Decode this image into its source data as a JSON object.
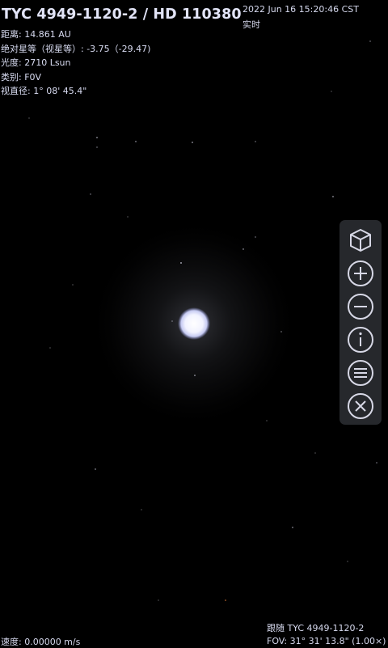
{
  "header": {
    "object_name": "TYC 4949-1120-2 / HD 110380",
    "datetime": "2022 Jun 16 15:20:46 CST",
    "time_mode": "实时"
  },
  "info": {
    "distance": "距离:  14.861 AU",
    "magnitude": "绝对星等（视星等）: -3.75（-29.47)",
    "luminosity": "光度: 2710 Lsun",
    "class": "类别:  F0V",
    "apparent_diameter": "视直径:  1° 08' 45.4\""
  },
  "status": {
    "speed": "速度:  0.00000 m/s",
    "follow": "跟随 TYC 4949-1120-2",
    "fov": "FOV:  31° 31' 13.8\" (1.00×)"
  },
  "toolbar": {
    "buttons": [
      {
        "name": "cube-view-icon"
      },
      {
        "name": "zoom-in-icon"
      },
      {
        "name": "zoom-out-icon"
      },
      {
        "name": "info-icon"
      },
      {
        "name": "menu-icon"
      },
      {
        "name": "close-icon"
      }
    ]
  },
  "colors": {
    "background": "#000000",
    "text": "#d6d9ee",
    "star_glow": "#eef0ff",
    "toolbar_bg": "#46485080"
  }
}
